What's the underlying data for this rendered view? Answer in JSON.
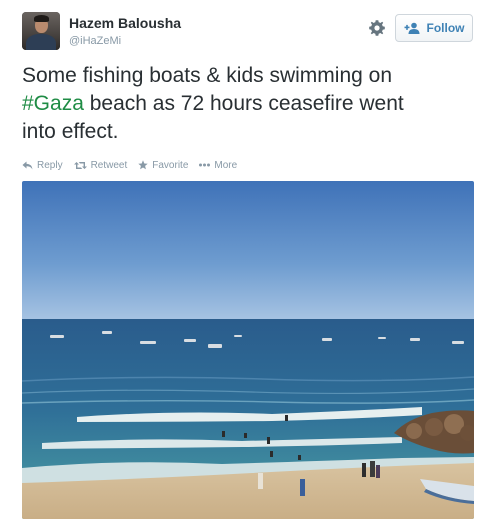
{
  "user": {
    "name": "Hazem Balousha",
    "handle": "@iHaZeMi"
  },
  "follow_button": {
    "label": "Follow",
    "icon": "add-user-icon"
  },
  "settings_icon": "gear-icon",
  "tweet": {
    "text_line1": "Some fishing boats & kids swimming on",
    "hashtag": "#Gaza",
    "text_line2_rest": " beach as 72 hours ceasefire went",
    "text_line3": "into effect."
  },
  "actions": [
    {
      "label": "Reply",
      "icon": "reply-icon"
    },
    {
      "label": "Retweet",
      "icon": "retweet-icon"
    },
    {
      "label": "Favorite",
      "icon": "star-icon"
    },
    {
      "label": "More",
      "icon": "more-dots-icon"
    }
  ],
  "colors": {
    "hashtag": "#1f8c45",
    "follow_text": "#3f82b5",
    "muted": "#8899a6",
    "text": "#292f33"
  }
}
